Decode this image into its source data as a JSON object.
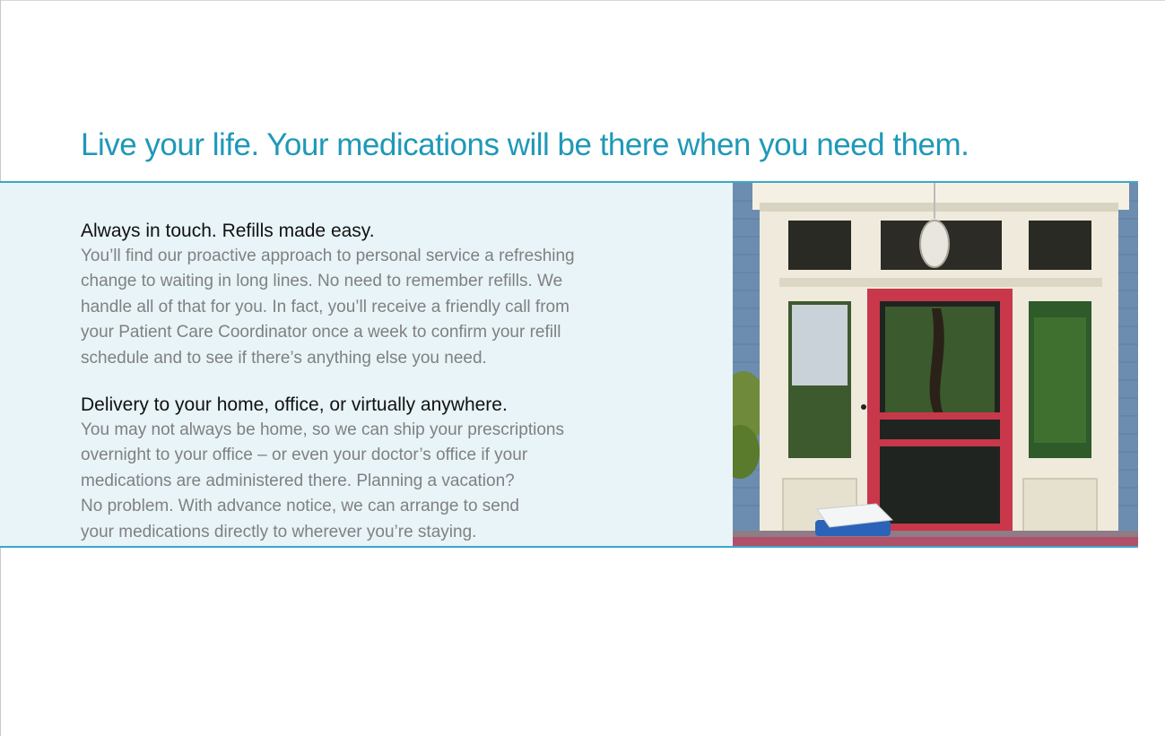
{
  "headline": "Live your life. Your medications will be there when you need them.",
  "sections": [
    {
      "title": "Always in touch. Refills made easy.",
      "lines": [
        "You’ll find our proactive approach to personal service a refreshing",
        "change to waiting in long lines. No need to remember refills. We",
        "handle all of that for you. In fact, you’ll receive a friendly call from",
        "your Patient Care Coordinator once a week to confirm your refill",
        "schedule and to see if there’s anything else you need."
      ]
    },
    {
      "title": "Delivery to your home, office, or virtually anywhere.",
      "lines": [
        "You may not always be home, so we can ship your prescriptions",
        "overnight to your office – or even your doctor’s office if your",
        "medications are administered there. Planning a vacation?",
        "No problem. With advance notice, we can arrange to send",
        "your medications directly to wherever you’re staying."
      ]
    }
  ],
  "colors": {
    "headline": "#1f98b8",
    "band_background": "#e8f4f8",
    "band_rule": "#3aa9c9",
    "door": "#c8384a",
    "cooler": "#2a63b8"
  }
}
